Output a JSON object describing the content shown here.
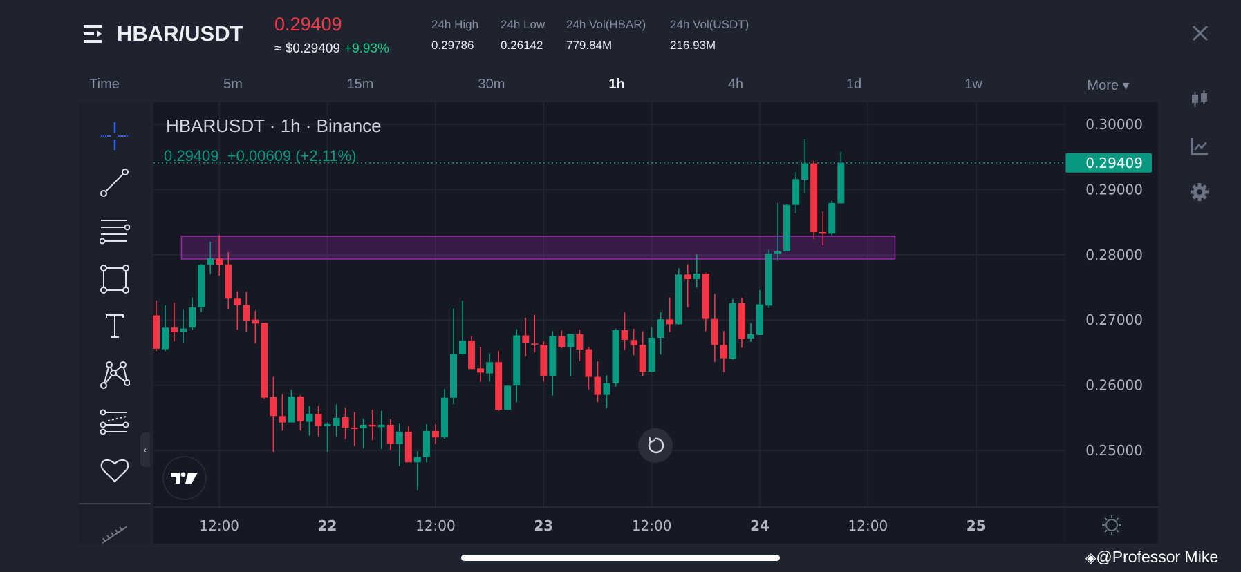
{
  "header": {
    "pair": "HBAR/USDT",
    "last_price": "0.29409",
    "approx_usd": "≈ $0.29409",
    "change_pct": "+9.93%",
    "stats": [
      {
        "label": "24h High",
        "value": "0.29786"
      },
      {
        "label": "24h Low",
        "value": "0.26142"
      },
      {
        "label": "24h Vol(HBAR)",
        "value": "779.84M"
      },
      {
        "label": "24h Vol(USDT)",
        "value": "216.93M"
      }
    ]
  },
  "timeframes": {
    "items": [
      "Time",
      "5m",
      "15m",
      "30m",
      "1h",
      "4h",
      "1d",
      "1w",
      "More ▾"
    ],
    "active": "1h"
  },
  "chart": {
    "title": "HBARUSDT · 1h · Binance",
    "legend": "0.29409  +0.00609 (+2.11%)"
  },
  "watermark": "@Professor Mike",
  "colors": {
    "up": "#089981",
    "down": "#f23645",
    "zone": "#9c27b0",
    "accent": "#2962ff"
  },
  "chart_data": {
    "type": "candlestick",
    "title": "HBARUSDT · 1h · Binance",
    "interval": "1h",
    "ylim": [
      0.2425,
      0.3025
    ],
    "y_ticks": [
      "0.30000",
      "0.29000",
      "0.28000",
      "0.27000",
      "0.26000",
      "0.25000"
    ],
    "y_tick_values": [
      0.3,
      0.29,
      0.28,
      0.27,
      0.26,
      0.25
    ],
    "x_ticks": [
      {
        "label": "12:00",
        "index": 7
      },
      {
        "label": "22",
        "index": 19
      },
      {
        "label": "12:00",
        "index": 31
      },
      {
        "label": "23",
        "index": 43
      },
      {
        "label": "12:00",
        "index": 55
      },
      {
        "label": "24",
        "index": 67
      },
      {
        "label": "12:00",
        "index": 79
      },
      {
        "label": "25",
        "index": 91
      }
    ],
    "last_price": 0.29409,
    "last_price_label": "0.29409",
    "zone": {
      "from_index": 2.8,
      "to_index": 82,
      "low": 0.27935,
      "high": 0.28284
    },
    "ohlc": [
      [
        0.2707,
        0.27299,
        0.26523,
        0.26558
      ],
      [
        0.26551,
        0.27229,
        0.26523,
        0.26883
      ],
      [
        0.26883,
        0.27264,
        0.26671,
        0.26812
      ],
      [
        0.26819,
        0.27157,
        0.26653,
        0.26869
      ],
      [
        0.26883,
        0.27345,
        0.26851,
        0.27193
      ],
      [
        0.27193,
        0.2786,
        0.27123,
        0.27846
      ],
      [
        0.27846,
        0.28199,
        0.27705,
        0.27945
      ],
      [
        0.27942,
        0.28298,
        0.2768,
        0.27846
      ],
      [
        0.27853,
        0.2804,
        0.27158,
        0.27327
      ],
      [
        0.27327,
        0.2744,
        0.26851,
        0.27228
      ],
      [
        0.27228,
        0.27433,
        0.26823,
        0.26989
      ],
      [
        0.27006,
        0.2714,
        0.26639,
        0.26946
      ],
      [
        0.26957,
        0.26957,
        0.25795,
        0.25809
      ],
      [
        0.25817,
        0.26127,
        0.24976,
        0.25527
      ],
      [
        0.25527,
        0.25862,
        0.25305,
        0.25428
      ],
      [
        0.25428,
        0.2593,
        0.25428,
        0.25827
      ],
      [
        0.25827,
        0.25845,
        0.25305,
        0.25446
      ],
      [
        0.25439,
        0.25682,
        0.25227,
        0.25562
      ],
      [
        0.25562,
        0.25682,
        0.25216,
        0.25375
      ],
      [
        0.25375,
        0.25428,
        0.24976,
        0.25404
      ],
      [
        0.25382,
        0.25704,
        0.25216,
        0.25499
      ],
      [
        0.25509,
        0.25658,
        0.25174,
        0.25347
      ],
      [
        0.25351,
        0.25587,
        0.25068,
        0.25329
      ],
      [
        0.2534,
        0.25488,
        0.25029,
        0.25393
      ],
      [
        0.25393,
        0.25623,
        0.25157,
        0.25368
      ],
      [
        0.25358,
        0.25605,
        0.25022,
        0.25393
      ],
      [
        0.25393,
        0.25481,
        0.25005,
        0.251
      ],
      [
        0.251,
        0.25411,
        0.24758,
        0.25287
      ],
      [
        0.25287,
        0.25368,
        0.24818,
        0.24818
      ],
      [
        0.24818,
        0.24987,
        0.24387,
        0.24899
      ],
      [
        0.24899,
        0.254,
        0.24818,
        0.25298
      ],
      [
        0.25298,
        0.254,
        0.251,
        0.25199
      ],
      [
        0.25199,
        0.2594,
        0.25181,
        0.25809
      ],
      [
        0.25809,
        0.27176,
        0.25711,
        0.2648
      ],
      [
        0.26477,
        0.27299,
        0.2647,
        0.26681
      ],
      [
        0.26681,
        0.26752,
        0.26247,
        0.26247
      ],
      [
        0.26258,
        0.26583,
        0.26053,
        0.26194
      ],
      [
        0.2618,
        0.26487,
        0.26053,
        0.26353
      ],
      [
        0.26353,
        0.26523,
        0.25605,
        0.25622
      ],
      [
        0.25622,
        0.25993,
        0.25622,
        0.25993
      ],
      [
        0.25993,
        0.26858,
        0.25739,
        0.26763
      ],
      [
        0.26763,
        0.27034,
        0.26445,
        0.26653
      ],
      [
        0.26639,
        0.2708,
        0.26505,
        0.26621
      ],
      [
        0.26621,
        0.26674,
        0.26053,
        0.26145
      ],
      [
        0.26145,
        0.2683,
        0.25841,
        0.26752
      ],
      [
        0.26752,
        0.2684,
        0.26565,
        0.26583
      ],
      [
        0.26583,
        0.26787,
        0.26134,
        0.26787
      ],
      [
        0.2678,
        0.26851,
        0.26371,
        0.26547
      ],
      [
        0.26551,
        0.26586,
        0.2593,
        0.26127
      ],
      [
        0.26127,
        0.26364,
        0.25739,
        0.25852
      ],
      [
        0.25852,
        0.26152,
        0.2565,
        0.2603
      ],
      [
        0.2603,
        0.26868,
        0.2598,
        0.26844
      ],
      [
        0.26844,
        0.27116,
        0.2654,
        0.26695
      ],
      [
        0.26692,
        0.26865,
        0.26459,
        0.26614
      ],
      [
        0.26618,
        0.2683,
        0.26145,
        0.26205
      ],
      [
        0.26205,
        0.26886,
        0.26205,
        0.26727
      ],
      [
        0.26727,
        0.27119,
        0.2647,
        0.2701
      ],
      [
        0.2701,
        0.27345,
        0.26815,
        0.26935
      ],
      [
        0.26935,
        0.27793,
        0.26928,
        0.27698
      ],
      [
        0.27698,
        0.27857,
        0.27193,
        0.27627
      ],
      [
        0.27627,
        0.28005,
        0.27493,
        0.27712
      ],
      [
        0.27712,
        0.27723,
        0.26829,
        0.27017
      ],
      [
        0.27017,
        0.27398,
        0.26353,
        0.26618
      ],
      [
        0.26618,
        0.2683,
        0.26198,
        0.26413
      ],
      [
        0.26406,
        0.27324,
        0.26392,
        0.27257
      ],
      [
        0.27257,
        0.27341,
        0.26575,
        0.2671
      ],
      [
        0.26717,
        0.26953,
        0.26664,
        0.2678
      ],
      [
        0.2677,
        0.27458,
        0.2677,
        0.27239
      ],
      [
        0.27222,
        0.28076,
        0.27186,
        0.28016
      ],
      [
        0.28016,
        0.28793,
        0.27907,
        0.28051
      ],
      [
        0.28051,
        0.28771,
        0.28051,
        0.28764
      ],
      [
        0.28764,
        0.29266,
        0.28634,
        0.2916
      ],
      [
        0.29153,
        0.29778,
        0.28941,
        0.294
      ],
      [
        0.294,
        0.29446,
        0.28246,
        0.28348
      ],
      [
        0.28348,
        0.28666,
        0.28147,
        0.28323
      ],
      [
        0.28323,
        0.28828,
        0.28298,
        0.28793
      ],
      [
        0.28789,
        0.29583,
        0.28789,
        0.29409
      ]
    ]
  }
}
